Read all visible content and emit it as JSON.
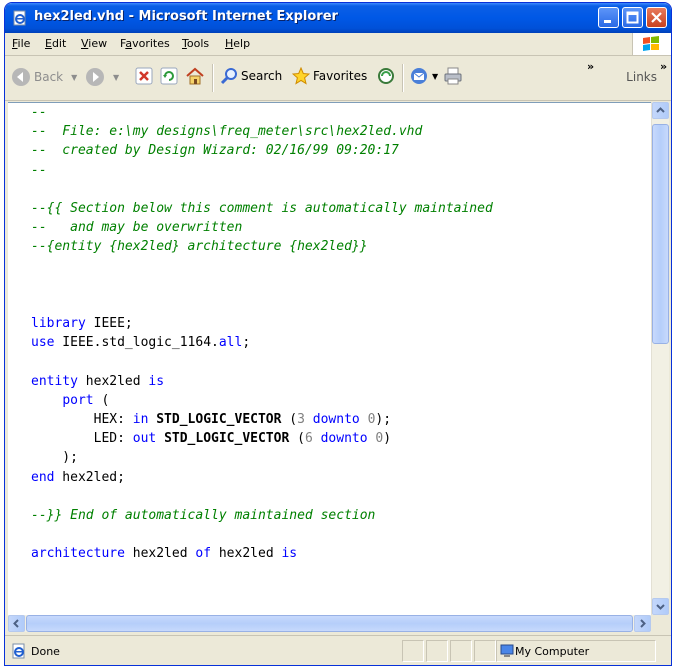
{
  "window": {
    "title": "hex2led.vhd - Microsoft Internet Explorer"
  },
  "menu": {
    "items": [
      {
        "u": "F",
        "rest": "ile"
      },
      {
        "u": "E",
        "rest": "dit"
      },
      {
        "u": "V",
        "rest": "iew"
      },
      {
        "pre": "F",
        "u": "a",
        "rest": "vorites"
      },
      {
        "u": "T",
        "rest": "ools"
      },
      {
        "u": "H",
        "rest": "elp"
      }
    ]
  },
  "toolbar": {
    "back_label": "Back",
    "search_label": "Search",
    "favorites_label": "Favorites",
    "links_label": "Links"
  },
  "code": {
    "lines": [
      [
        [
          "cm",
          "--"
        ]
      ],
      [
        [
          "cm",
          "--  File: e:\\my designs\\freq_meter\\src\\hex2led.vhd"
        ]
      ],
      [
        [
          "cm",
          "--  created by Design Wizard: 02/16/99 09:20:17"
        ]
      ],
      [
        [
          "cm",
          "--"
        ]
      ],
      [
        [
          "",
          ""
        ]
      ],
      [
        [
          "cm",
          "--{{ Section below this comment is automatically maintained"
        ]
      ],
      [
        [
          "cm",
          "--   and may be overwritten"
        ]
      ],
      [
        [
          "cm",
          "--{entity {hex2led} architecture {hex2led}}"
        ]
      ],
      [
        [
          "",
          ""
        ]
      ],
      [
        [
          "",
          ""
        ]
      ],
      [
        [
          "",
          ""
        ]
      ],
      [
        [
          "kw",
          "library"
        ],
        [
          "",
          " IEEE;"
        ]
      ],
      [
        [
          "kw",
          "use"
        ],
        [
          "",
          " IEEE.std_logic_1164."
        ],
        [
          "kw",
          "all"
        ],
        [
          "",
          ";"
        ]
      ],
      [
        [
          "",
          ""
        ]
      ],
      [
        [
          "kw",
          "entity"
        ],
        [
          "",
          " hex2led "
        ],
        [
          "kw",
          "is"
        ]
      ],
      [
        [
          "",
          "    "
        ],
        [
          "kw",
          "port"
        ],
        [
          "",
          " ("
        ]
      ],
      [
        [
          "",
          "        HEX: "
        ],
        [
          "kw",
          "in"
        ],
        [
          "",
          " "
        ],
        [
          "b",
          "STD_LOGIC_VECTOR"
        ],
        [
          "",
          " ("
        ],
        [
          "num",
          "3"
        ],
        [
          "",
          " "
        ],
        [
          "kw",
          "downto"
        ],
        [
          "",
          " "
        ],
        [
          "num",
          "0"
        ],
        [
          "",
          ");"
        ]
      ],
      [
        [
          "",
          "        LED: "
        ],
        [
          "kw",
          "out"
        ],
        [
          "",
          " "
        ],
        [
          "b",
          "STD_LOGIC_VECTOR"
        ],
        [
          "",
          " ("
        ],
        [
          "num",
          "6"
        ],
        [
          "",
          " "
        ],
        [
          "kw",
          "downto"
        ],
        [
          "",
          " "
        ],
        [
          "num",
          "0"
        ],
        [
          "",
          ")"
        ]
      ],
      [
        [
          "",
          "    );"
        ]
      ],
      [
        [
          "kw",
          "end"
        ],
        [
          "",
          " hex2led;"
        ]
      ],
      [
        [
          "",
          ""
        ]
      ],
      [
        [
          "cm",
          "--}} End of automatically maintained section"
        ]
      ],
      [
        [
          "",
          ""
        ]
      ],
      [
        [
          "kw",
          "architecture"
        ],
        [
          "",
          " hex2led "
        ],
        [
          "kw",
          "of"
        ],
        [
          "",
          " hex2led "
        ],
        [
          "kw",
          "is"
        ]
      ]
    ]
  },
  "status": {
    "text": "Done",
    "zone": "My Computer"
  },
  "colors": {
    "comment": "#008000",
    "keyword": "#0000ff",
    "number": "#808080",
    "titlebar": "#0058e6"
  }
}
